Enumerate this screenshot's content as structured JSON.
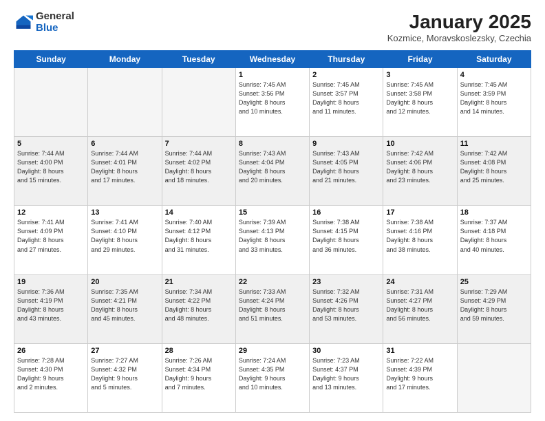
{
  "logo": {
    "general": "General",
    "blue": "Blue"
  },
  "title": "January 2025",
  "subtitle": "Kozmice, Moravskoslezsky, Czechia",
  "days_of_week": [
    "Sunday",
    "Monday",
    "Tuesday",
    "Wednesday",
    "Thursday",
    "Friday",
    "Saturday"
  ],
  "weeks": [
    [
      {
        "num": "",
        "info": ""
      },
      {
        "num": "",
        "info": ""
      },
      {
        "num": "",
        "info": ""
      },
      {
        "num": "1",
        "info": "Sunrise: 7:45 AM\nSunset: 3:56 PM\nDaylight: 8 hours\nand 10 minutes."
      },
      {
        "num": "2",
        "info": "Sunrise: 7:45 AM\nSunset: 3:57 PM\nDaylight: 8 hours\nand 11 minutes."
      },
      {
        "num": "3",
        "info": "Sunrise: 7:45 AM\nSunset: 3:58 PM\nDaylight: 8 hours\nand 12 minutes."
      },
      {
        "num": "4",
        "info": "Sunrise: 7:45 AM\nSunset: 3:59 PM\nDaylight: 8 hours\nand 14 minutes."
      }
    ],
    [
      {
        "num": "5",
        "info": "Sunrise: 7:44 AM\nSunset: 4:00 PM\nDaylight: 8 hours\nand 15 minutes."
      },
      {
        "num": "6",
        "info": "Sunrise: 7:44 AM\nSunset: 4:01 PM\nDaylight: 8 hours\nand 17 minutes."
      },
      {
        "num": "7",
        "info": "Sunrise: 7:44 AM\nSunset: 4:02 PM\nDaylight: 8 hours\nand 18 minutes."
      },
      {
        "num": "8",
        "info": "Sunrise: 7:43 AM\nSunset: 4:04 PM\nDaylight: 8 hours\nand 20 minutes."
      },
      {
        "num": "9",
        "info": "Sunrise: 7:43 AM\nSunset: 4:05 PM\nDaylight: 8 hours\nand 21 minutes."
      },
      {
        "num": "10",
        "info": "Sunrise: 7:42 AM\nSunset: 4:06 PM\nDaylight: 8 hours\nand 23 minutes."
      },
      {
        "num": "11",
        "info": "Sunrise: 7:42 AM\nSunset: 4:08 PM\nDaylight: 8 hours\nand 25 minutes."
      }
    ],
    [
      {
        "num": "12",
        "info": "Sunrise: 7:41 AM\nSunset: 4:09 PM\nDaylight: 8 hours\nand 27 minutes."
      },
      {
        "num": "13",
        "info": "Sunrise: 7:41 AM\nSunset: 4:10 PM\nDaylight: 8 hours\nand 29 minutes."
      },
      {
        "num": "14",
        "info": "Sunrise: 7:40 AM\nSunset: 4:12 PM\nDaylight: 8 hours\nand 31 minutes."
      },
      {
        "num": "15",
        "info": "Sunrise: 7:39 AM\nSunset: 4:13 PM\nDaylight: 8 hours\nand 33 minutes."
      },
      {
        "num": "16",
        "info": "Sunrise: 7:38 AM\nSunset: 4:15 PM\nDaylight: 8 hours\nand 36 minutes."
      },
      {
        "num": "17",
        "info": "Sunrise: 7:38 AM\nSunset: 4:16 PM\nDaylight: 8 hours\nand 38 minutes."
      },
      {
        "num": "18",
        "info": "Sunrise: 7:37 AM\nSunset: 4:18 PM\nDaylight: 8 hours\nand 40 minutes."
      }
    ],
    [
      {
        "num": "19",
        "info": "Sunrise: 7:36 AM\nSunset: 4:19 PM\nDaylight: 8 hours\nand 43 minutes."
      },
      {
        "num": "20",
        "info": "Sunrise: 7:35 AM\nSunset: 4:21 PM\nDaylight: 8 hours\nand 45 minutes."
      },
      {
        "num": "21",
        "info": "Sunrise: 7:34 AM\nSunset: 4:22 PM\nDaylight: 8 hours\nand 48 minutes."
      },
      {
        "num": "22",
        "info": "Sunrise: 7:33 AM\nSunset: 4:24 PM\nDaylight: 8 hours\nand 51 minutes."
      },
      {
        "num": "23",
        "info": "Sunrise: 7:32 AM\nSunset: 4:26 PM\nDaylight: 8 hours\nand 53 minutes."
      },
      {
        "num": "24",
        "info": "Sunrise: 7:31 AM\nSunset: 4:27 PM\nDaylight: 8 hours\nand 56 minutes."
      },
      {
        "num": "25",
        "info": "Sunrise: 7:29 AM\nSunset: 4:29 PM\nDaylight: 8 hours\nand 59 minutes."
      }
    ],
    [
      {
        "num": "26",
        "info": "Sunrise: 7:28 AM\nSunset: 4:30 PM\nDaylight: 9 hours\nand 2 minutes."
      },
      {
        "num": "27",
        "info": "Sunrise: 7:27 AM\nSunset: 4:32 PM\nDaylight: 9 hours\nand 5 minutes."
      },
      {
        "num": "28",
        "info": "Sunrise: 7:26 AM\nSunset: 4:34 PM\nDaylight: 9 hours\nand 7 minutes."
      },
      {
        "num": "29",
        "info": "Sunrise: 7:24 AM\nSunset: 4:35 PM\nDaylight: 9 hours\nand 10 minutes."
      },
      {
        "num": "30",
        "info": "Sunrise: 7:23 AM\nSunset: 4:37 PM\nDaylight: 9 hours\nand 13 minutes."
      },
      {
        "num": "31",
        "info": "Sunrise: 7:22 AM\nSunset: 4:39 PM\nDaylight: 9 hours\nand 17 minutes."
      },
      {
        "num": "",
        "info": ""
      }
    ]
  ]
}
